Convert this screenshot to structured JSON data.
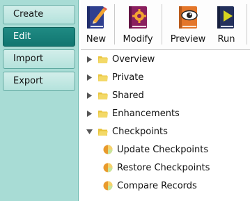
{
  "sidebar": {
    "items": [
      {
        "label": "Create",
        "active": false
      },
      {
        "label": "Edit",
        "active": true
      },
      {
        "label": "Import",
        "active": false
      },
      {
        "label": "Export",
        "active": false
      }
    ]
  },
  "toolbar": {
    "new_label": "New",
    "modify_label": "Modify",
    "preview_label": "Preview",
    "run_label": "Run",
    "icons": {
      "new": "book-pencil-icon",
      "modify": "book-gear-icon",
      "preview": "book-eye-icon",
      "run": "book-play-icon"
    }
  },
  "tree": {
    "folders": [
      {
        "label": "Overview",
        "expanded": false
      },
      {
        "label": "Private",
        "expanded": false
      },
      {
        "label": "Shared",
        "expanded": false
      },
      {
        "label": "Enhancements",
        "expanded": false
      },
      {
        "label": "Checkpoints",
        "expanded": true
      }
    ],
    "checkpoint_items": [
      {
        "label": "Update Checkpoints"
      },
      {
        "label": "Restore Checkpoints"
      },
      {
        "label": "Compare Records"
      }
    ]
  },
  "colors": {
    "sidebar_bg": "#a8dcd5",
    "active_tab": "#117670",
    "folder": "#e9c43c"
  }
}
